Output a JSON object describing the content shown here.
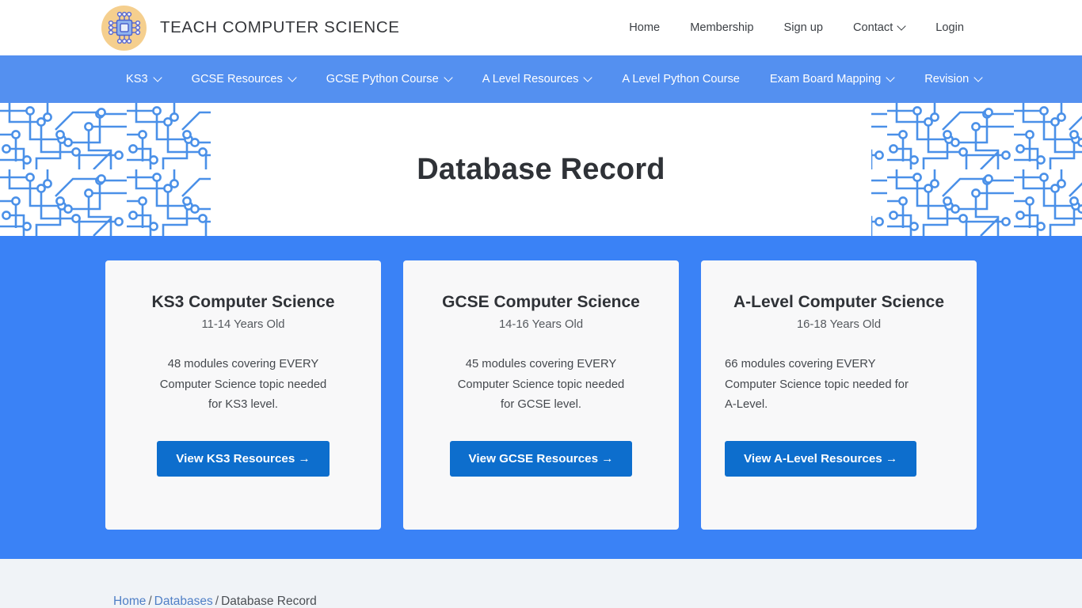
{
  "header": {
    "logo_icon": "microchip-icon",
    "brand_name": "TEACH COMPUTER SCIENCE",
    "nav": [
      {
        "label": "Home",
        "caret": false
      },
      {
        "label": "Membership",
        "caret": false
      },
      {
        "label": "Sign up",
        "caret": false
      },
      {
        "label": "Contact",
        "caret": true
      },
      {
        "label": "Login",
        "caret": false
      }
    ]
  },
  "mainnav": {
    "items": [
      {
        "label": "KS3",
        "caret": true
      },
      {
        "label": "GCSE Resources",
        "caret": true
      },
      {
        "label": "GCSE Python Course",
        "caret": true
      },
      {
        "label": "A Level Resources",
        "caret": true
      },
      {
        "label": "A Level Python Course",
        "caret": false
      },
      {
        "label": "Exam Board Mapping",
        "caret": true
      },
      {
        "label": "Revision",
        "caret": true
      }
    ]
  },
  "hero": {
    "title": "Database Record"
  },
  "cards": [
    {
      "title": "KS3 Computer Science",
      "age": "11-14 Years Old",
      "description": "48 modules covering EVERY Computer Science topic needed for KS3 level.",
      "button": "View KS3 Resources →"
    },
    {
      "title": "GCSE Computer Science",
      "age": "14-16 Years Old",
      "description": "45 modules covering EVERY Computer Science topic needed for GCSE level.",
      "button": "View GCSE Resources →"
    },
    {
      "title": "A-Level Computer Science",
      "age": "16-18 Years Old",
      "description": "66 modules covering EVERY Computer Science topic needed for A-Level.",
      "button": "View A-Level Resources →"
    }
  ],
  "breadcrumb": {
    "home": "Home",
    "sep1": "/",
    "databases": "Databases",
    "sep2": "/",
    "current": "Database Record"
  },
  "colors": {
    "nav_blue": "#5490f0",
    "section_blue": "#3a82f6",
    "button_blue": "#0d6ecd",
    "card_bg": "#f8f8f9",
    "breadcrumb_bg": "#f0f3f7",
    "logo_bg": "#f5cf8e",
    "circuit_line": "#4a90e8"
  }
}
